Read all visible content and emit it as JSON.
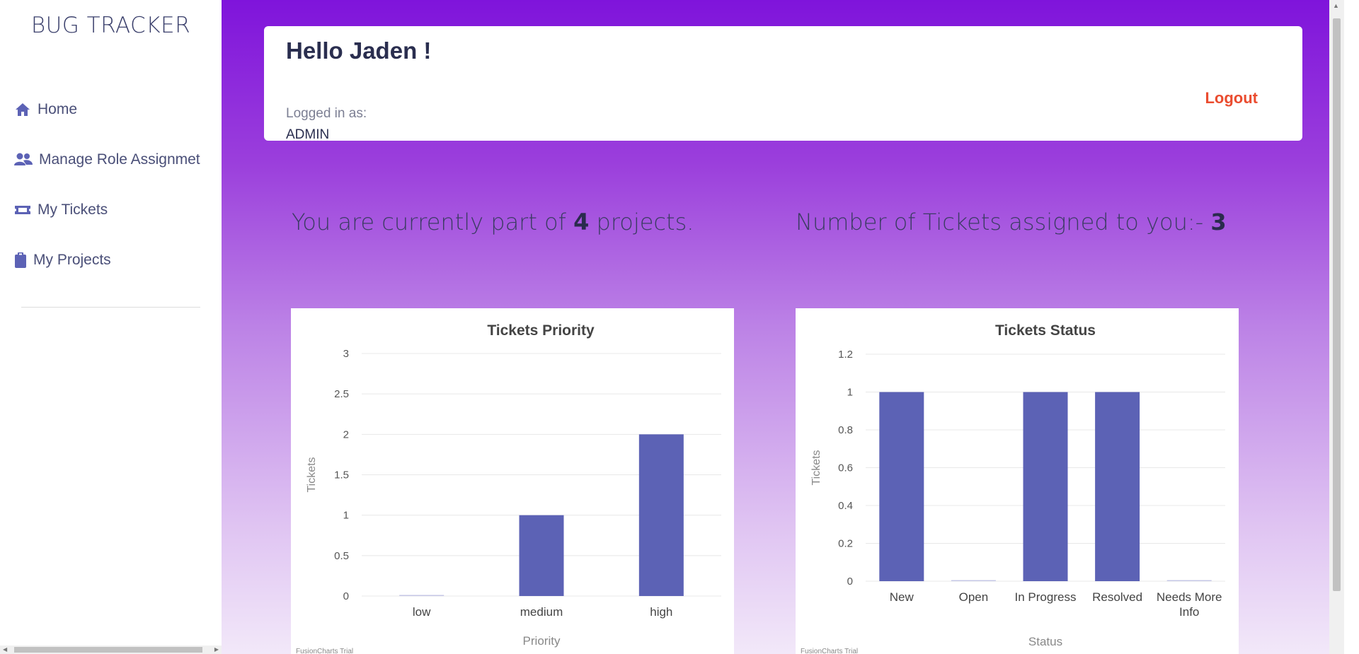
{
  "sidebar": {
    "brand": "BUG TRACKER",
    "items": [
      {
        "label": "Home",
        "icon": "home-icon"
      },
      {
        "label": "Manage Role Assignmet",
        "icon": "users-icon"
      },
      {
        "label": "My Tickets",
        "icon": "ticket-icon"
      },
      {
        "label": "My Projects",
        "icon": "clipboard-icon"
      }
    ]
  },
  "header": {
    "greeting": "Hello Jaden !",
    "logged_in_label": "Logged in as:",
    "role": "ADMIN",
    "logout_label": "Logout"
  },
  "stats": {
    "projects_prefix": "You are currently part of",
    "projects_count": "4",
    "projects_suffix": "projects.",
    "tickets_prefix": "Number of Tickets assigned to you:-",
    "tickets_count": "3"
  },
  "colors": {
    "bar": "#5c62b5",
    "accent_purple": "#7f14db",
    "logout": "#ea4c2f"
  },
  "chart_data": [
    {
      "type": "bar",
      "title": "Tickets Priority",
      "xlabel": "Priority",
      "ylabel": "Tickets",
      "categories": [
        "low",
        "medium",
        "high"
      ],
      "values": [
        0,
        1,
        2
      ],
      "ylim": [
        0,
        3
      ],
      "yticks": [
        "0",
        "0.5",
        "1",
        "1.5",
        "2",
        "2.5",
        "3"
      ],
      "ytick_values": [
        0,
        0.5,
        1,
        1.5,
        2,
        2.5,
        3
      ],
      "grid": true,
      "watermark": "FusionCharts Trial"
    },
    {
      "type": "bar",
      "title": "Tickets Status",
      "xlabel": "Status",
      "ylabel": "Tickets",
      "categories": [
        "New",
        "Open",
        "In Progress",
        "Resolved",
        "Needs More Info"
      ],
      "values": [
        1,
        0,
        1,
        1,
        0
      ],
      "ylim": [
        0,
        1.2
      ],
      "yticks": [
        "0",
        "0.2",
        "0.4",
        "0.6",
        "0.8",
        "1",
        "1.2"
      ],
      "ytick_values": [
        0,
        0.2,
        0.4,
        0.6,
        0.8,
        1,
        1.2
      ],
      "grid": true,
      "watermark": "FusionCharts Trial"
    }
  ]
}
